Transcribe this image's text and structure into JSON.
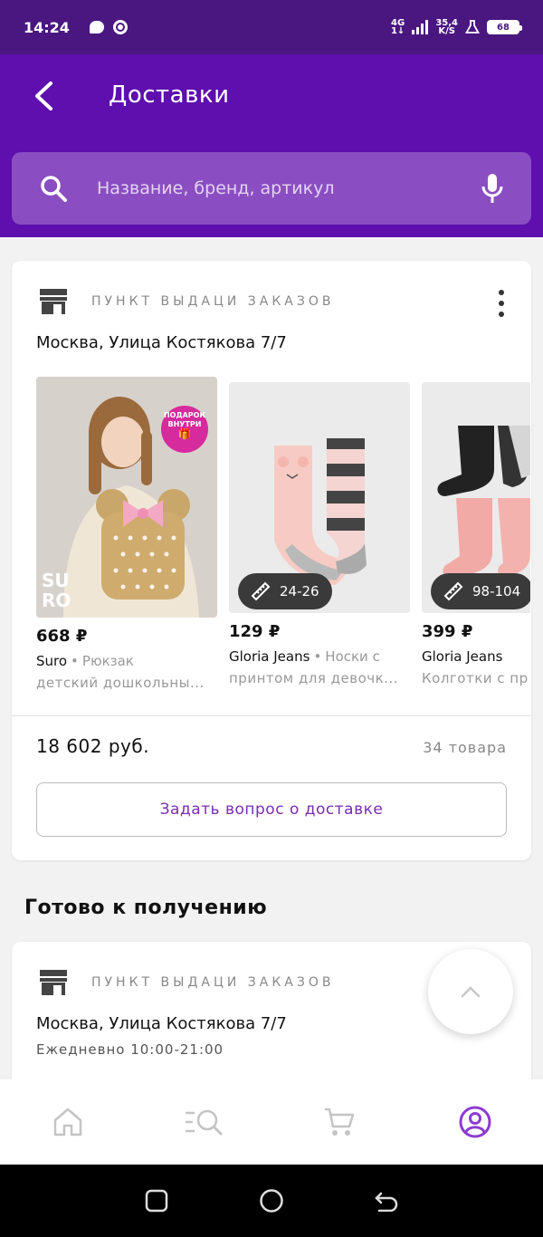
{
  "status_bar": {
    "time": "14:24",
    "network_type": "4G",
    "network_sub": "1↓",
    "speed_value": "35,4",
    "speed_unit": "K/S",
    "battery": "68"
  },
  "header": {
    "title": "Доставки",
    "back_icon": "back-arrow-icon"
  },
  "search": {
    "placeholder": "Название, бренд, артикул"
  },
  "delivery_card": {
    "pickup_label": "ПУНКТ ВЫДАЦИ ЗАКАЗОВ",
    "address": "Москва, Улица Костякова 7/7",
    "products": [
      {
        "price": "668 ₽",
        "brand": "Suro",
        "separator": "•",
        "description": "Рюкзак",
        "description_line2": "детский дошкольны...",
        "image_badge_top": "ПОДАРОК",
        "image_badge_bottom": "ВНУТРИ",
        "image_logo_top": "SU",
        "image_logo_bottom": "RO"
      },
      {
        "price": "129 ₽",
        "brand": "Gloria Jeans",
        "separator": "•",
        "description": "Носки с",
        "description_line2": "принтом для девочк...",
        "size": "24-26"
      },
      {
        "price": "399 ₽",
        "brand": "Gloria Jeans",
        "separator": "",
        "description": "",
        "description_line2": "Колготки с пр",
        "size": "98-104"
      }
    ],
    "total": "18 602 руб.",
    "items_count": "34 товара",
    "ask_button": "Задать вопрос о доставке"
  },
  "ready_section": {
    "title": "Готово к получению",
    "pickup_label": "ПУНКТ ВЫДАЦИ ЗАКАЗОВ",
    "address": "Москва, Улица Костякова 7/7",
    "hours": "Ежедневно 10:00-21:00"
  },
  "bottom_nav": [
    "home-icon",
    "catalog-search-icon",
    "cart-icon",
    "profile-icon"
  ],
  "colors": {
    "status_bar": "#4a1780",
    "app_bar": "#5e0fad",
    "search_bg": "#8a4ec2",
    "accent": "#7a2db3",
    "active_nav": "#8e3bd1"
  }
}
